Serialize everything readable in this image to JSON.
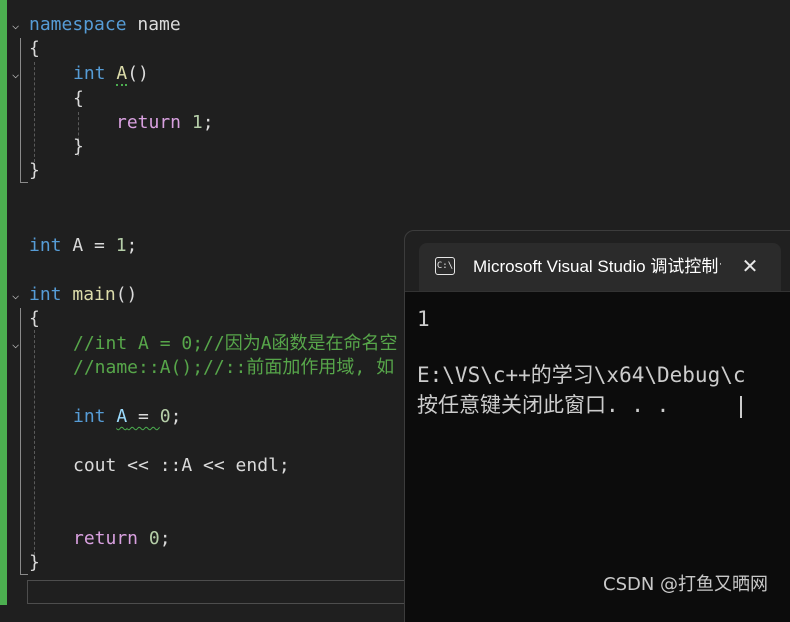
{
  "editor": {
    "line_namespace": {
      "kw": "namespace",
      "name": " name"
    },
    "brace_open": "{",
    "line_func": {
      "kw": "int",
      "name": "A",
      "parens": "()"
    },
    "func_brace_open": "{",
    "line_return1": {
      "kw": "return",
      "num": "1",
      "semi": ";"
    },
    "func_brace_close": "}",
    "brace_close": "}",
    "line_global": {
      "kw": "int",
      "rest": " A = ",
      "num": "1",
      "semi": ";"
    },
    "line_main": {
      "kw": "int",
      "name": "main",
      "parens": "()"
    },
    "main_brace_open": "{",
    "comment1": "//int A = 0;//因为A函数是在命名空",
    "comment2": "//name::A();//::前面加作用域, 如",
    "line_local": {
      "kw": "int",
      "space": " ",
      "name": "A",
      "eq": " = ",
      "num": "0",
      "semi": ";"
    },
    "line_cout": "cout << ::A << endl;",
    "line_return0": {
      "kw": "return",
      "space": " ",
      "num": "0",
      "semi": ";"
    },
    "main_brace_close": "}"
  },
  "console": {
    "title": "Microsoft Visual Studio 调试控制台",
    "icon_label": "C:\\",
    "close_glyph": "✕",
    "output_line1": "1",
    "output_line2": "E:\\VS\\c++的学习\\x64\\Debug\\c",
    "output_line3": "按任意键关闭此窗口. . ."
  },
  "watermark": "CSDN @打鱼又晒网",
  "colors": {
    "keyword": "#569cd6",
    "function": "#dcdcaa",
    "number": "#b5cea8",
    "comment": "#57a64a",
    "control": "#d8a0df",
    "change_bar": "#4caf50"
  }
}
